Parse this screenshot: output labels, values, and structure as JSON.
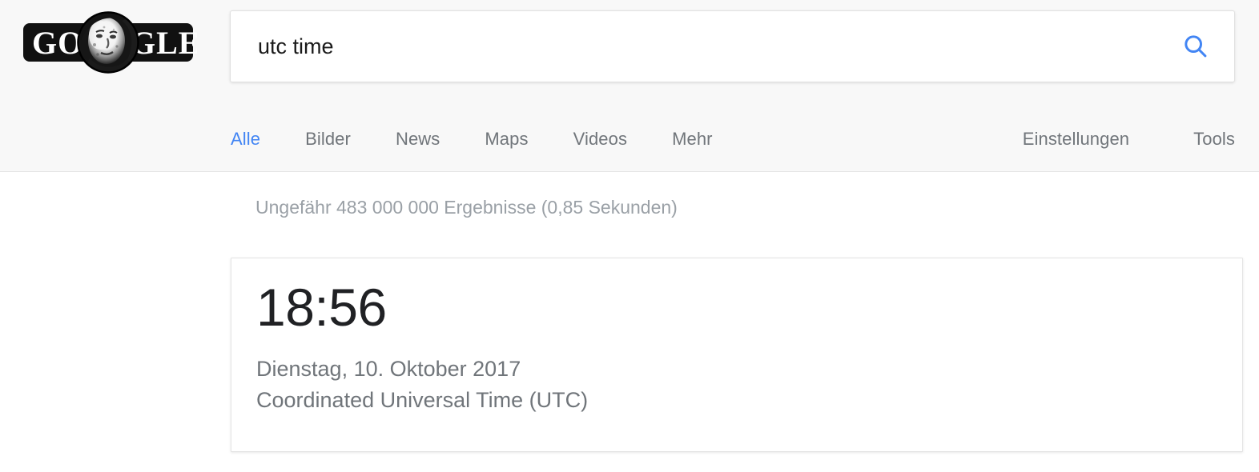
{
  "header": {
    "logo": {
      "name": "google-doodle-logo",
      "text_left": "GO",
      "text_right": "GLE",
      "alt": "Google Doodle"
    },
    "search": {
      "value": "utc time",
      "placeholder": "",
      "button_icon": "search-icon",
      "button_label": "Google Suche",
      "accent_color": "#4285f4"
    },
    "nav": {
      "tabs": [
        {
          "label": "Alle",
          "active": true
        },
        {
          "label": "Bilder",
          "active": false
        },
        {
          "label": "News",
          "active": false
        },
        {
          "label": "Maps",
          "active": false
        },
        {
          "label": "Videos",
          "active": false
        },
        {
          "label": "Mehr",
          "active": false
        }
      ],
      "right_items": [
        {
          "label": "Einstellungen"
        },
        {
          "label": "Tools"
        }
      ],
      "active_color": "#4285f4",
      "inactive_color": "#70757a"
    }
  },
  "main": {
    "result_stats": "Ungefähr 483 000 000 Ergebnisse (0,85 Sekunden)",
    "answer_card": {
      "time": "18:56",
      "date": "Dienstag, 10. Oktober 2017",
      "timezone": "Coordinated Universal Time (UTC)"
    }
  }
}
